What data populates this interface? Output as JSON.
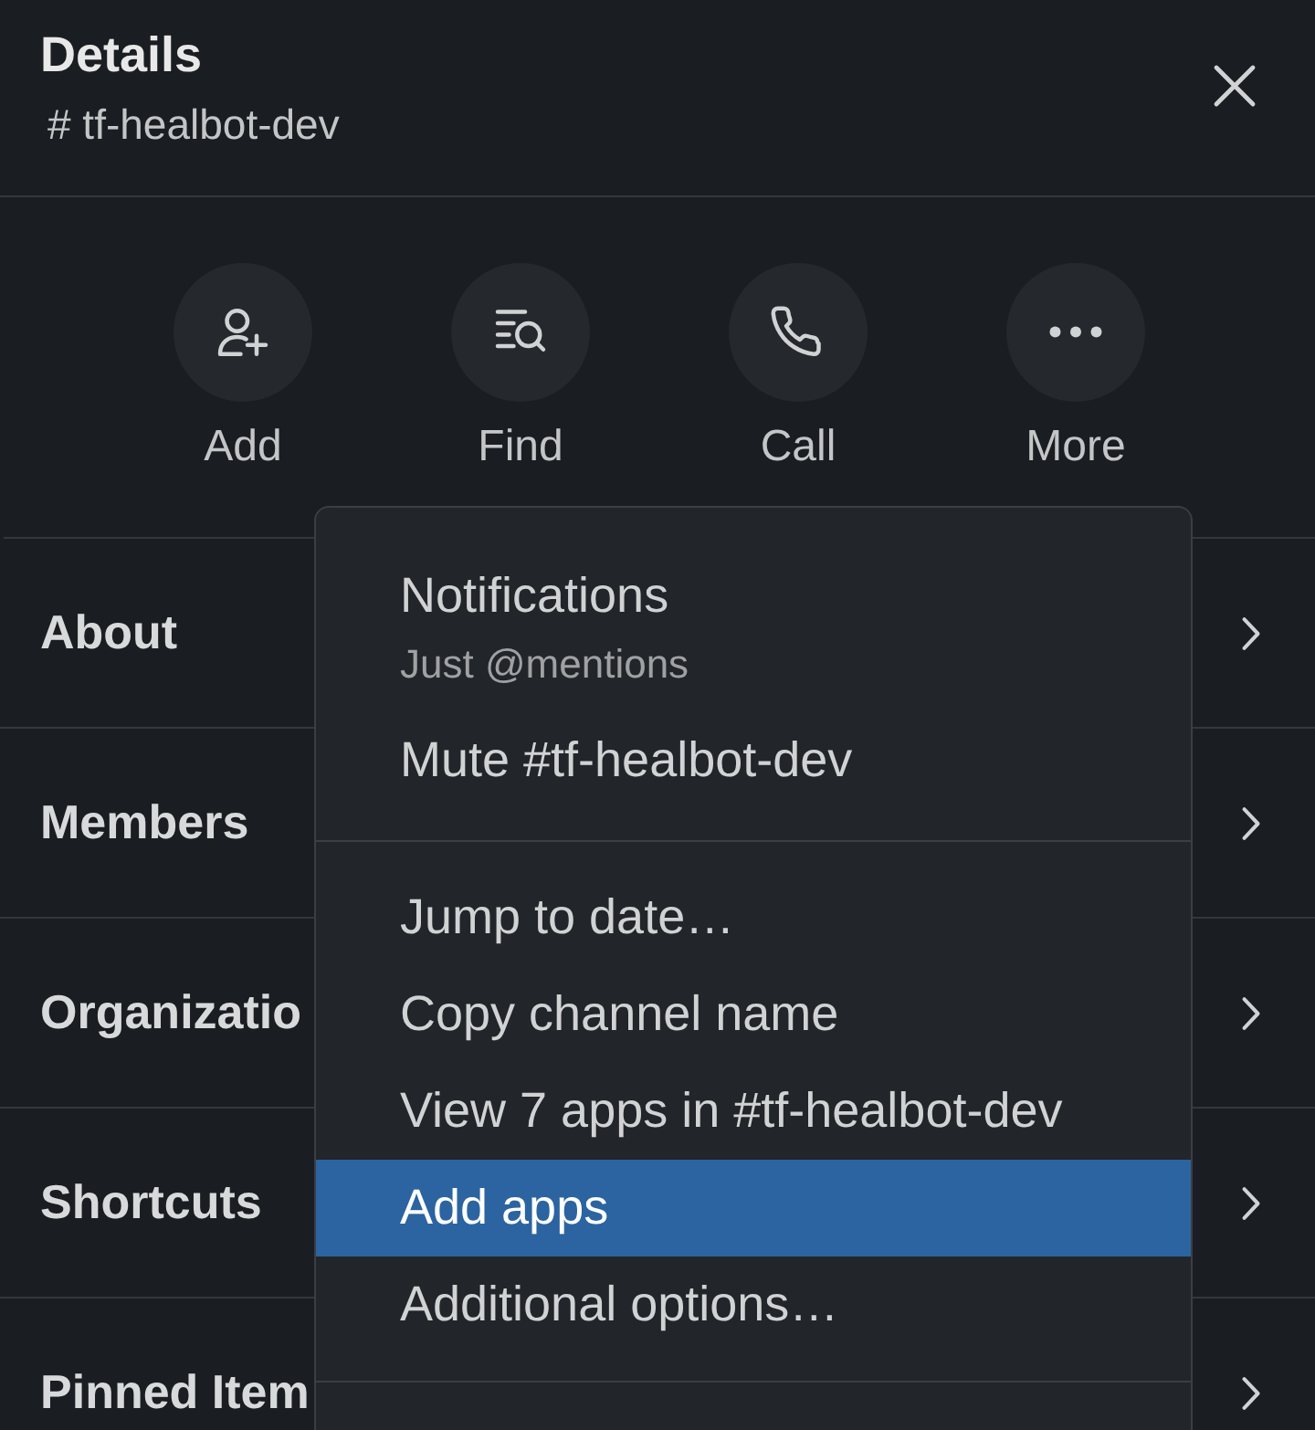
{
  "header": {
    "title": "Details",
    "channel": "# tf-healbot-dev"
  },
  "actions": [
    {
      "kind": "add_person",
      "label": "Add"
    },
    {
      "kind": "find",
      "label": "Find"
    },
    {
      "kind": "call",
      "label": "Call"
    },
    {
      "kind": "more",
      "label": "More"
    }
  ],
  "sections": [
    {
      "label": "About"
    },
    {
      "label": "Members"
    },
    {
      "label": "Organizatio"
    },
    {
      "label": "Shortcuts"
    },
    {
      "label": "Pinned Item"
    }
  ],
  "menu": {
    "groups": [
      {
        "items": [
          {
            "label": "Notifications",
            "detail": "Just @mentions",
            "selected": false
          },
          {
            "label": "Mute #tf-healbot-dev",
            "selected": false
          }
        ]
      },
      {
        "items": [
          {
            "label": "Jump to date…",
            "selected": false
          },
          {
            "label": "Copy channel name",
            "selected": false
          },
          {
            "label": "View 7 apps in #tf-healbot-dev",
            "selected": false
          },
          {
            "label": "Add apps",
            "selected": true
          },
          {
            "label": "Additional options…",
            "selected": false
          }
        ]
      }
    ]
  }
}
